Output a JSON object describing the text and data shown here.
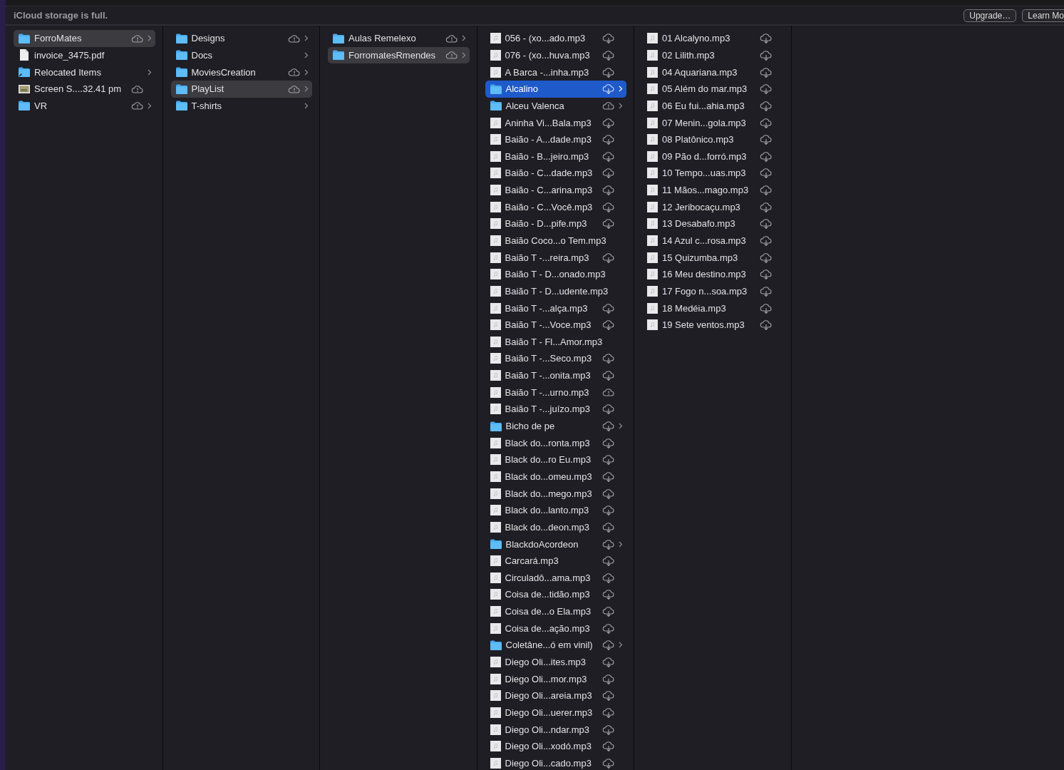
{
  "banner": {
    "message": "iCloud storage is full.",
    "buttons": [
      "Upgrade…",
      "Learn Mo"
    ]
  },
  "columns": [
    {
      "active": false,
      "items": [
        {
          "name": "ForroMates",
          "kind": "folder",
          "sync_warning": true,
          "needs_download": false,
          "selected": true
        },
        {
          "name": "invoice_3475.pdf",
          "kind": "document",
          "sync_warning": false,
          "needs_download": false,
          "selected": false
        },
        {
          "name": "Relocated Items",
          "kind": "alias",
          "sync_warning": false,
          "needs_download": false,
          "selected": false
        },
        {
          "name": "Screen S....32.41 pm",
          "kind": "image",
          "sync_warning": true,
          "needs_download": false,
          "selected": false
        },
        {
          "name": "VR",
          "kind": "folder",
          "sync_warning": true,
          "needs_download": false,
          "selected": false
        }
      ]
    },
    {
      "active": false,
      "items": [
        {
          "name": "Designs",
          "kind": "folder",
          "sync_warning": true,
          "needs_download": false,
          "selected": false
        },
        {
          "name": "Docs",
          "kind": "folder",
          "sync_warning": false,
          "needs_download": false,
          "selected": false
        },
        {
          "name": "MoviesCreation",
          "kind": "folder",
          "sync_warning": true,
          "needs_download": false,
          "selected": false
        },
        {
          "name": "PlayList",
          "kind": "folder",
          "sync_warning": true,
          "needs_download": false,
          "selected": true
        },
        {
          "name": "T-shirts",
          "kind": "folder",
          "sync_warning": false,
          "needs_download": false,
          "selected": false
        }
      ]
    },
    {
      "active": false,
      "items": [
        {
          "name": "Aulas Remelexo",
          "kind": "folder",
          "sync_warning": true,
          "needs_download": false,
          "selected": false
        },
        {
          "name": "ForromatesRmendes",
          "kind": "folder",
          "sync_warning": true,
          "needs_download": false,
          "selected": true
        }
      ]
    },
    {
      "active": true,
      "items": [
        {
          "name": "056 - (xo...ado.mp3",
          "kind": "audio",
          "sync_warning": false,
          "needs_download": true,
          "selected": false
        },
        {
          "name": "076 - (xo...huva.mp3",
          "kind": "audio",
          "sync_warning": false,
          "needs_download": true,
          "selected": false
        },
        {
          "name": "A Barca -...inha.mp3",
          "kind": "audio",
          "sync_warning": false,
          "needs_download": true,
          "selected": false
        },
        {
          "name": "Alcalino",
          "kind": "folder",
          "sync_warning": false,
          "needs_download": true,
          "selected": true
        },
        {
          "name": "Alceu Valenca",
          "kind": "folder",
          "sync_warning": true,
          "needs_download": false,
          "selected": false
        },
        {
          "name": "Aninha Vi...Bala.mp3",
          "kind": "audio",
          "sync_warning": false,
          "needs_download": true,
          "selected": false
        },
        {
          "name": "Baião - A...dade.mp3",
          "kind": "audio",
          "sync_warning": false,
          "needs_download": true,
          "selected": false
        },
        {
          "name": "Baião - B...jeiro.mp3",
          "kind": "audio",
          "sync_warning": false,
          "needs_download": true,
          "selected": false
        },
        {
          "name": "Baião - C...dade.mp3",
          "kind": "audio",
          "sync_warning": false,
          "needs_download": true,
          "selected": false
        },
        {
          "name": "Baião - C...arina.mp3",
          "kind": "audio",
          "sync_warning": false,
          "needs_download": true,
          "selected": false
        },
        {
          "name": "Baião - C...Você.mp3",
          "kind": "audio",
          "sync_warning": false,
          "needs_download": true,
          "selected": false
        },
        {
          "name": "Baião - D...pife.mp3",
          "kind": "audio",
          "sync_warning": false,
          "needs_download": true,
          "selected": false
        },
        {
          "name": "Baião Coco...o Tem.mp3",
          "kind": "audio",
          "sync_warning": false,
          "needs_download": false,
          "selected": false
        },
        {
          "name": "Baião T -...reira.mp3",
          "kind": "audio",
          "sync_warning": false,
          "needs_download": true,
          "selected": false
        },
        {
          "name": "Baião T - D...onado.mp3",
          "kind": "audio",
          "sync_warning": false,
          "needs_download": false,
          "selected": false
        },
        {
          "name": "Baião T - D...udente.mp3",
          "kind": "audio",
          "sync_warning": false,
          "needs_download": false,
          "selected": false
        },
        {
          "name": "Baião T -...alça.mp3",
          "kind": "audio",
          "sync_warning": false,
          "needs_download": true,
          "selected": false
        },
        {
          "name": "Baião T -...Voce.mp3",
          "kind": "audio",
          "sync_warning": false,
          "needs_download": true,
          "selected": false
        },
        {
          "name": "Baião T - Fl...Amor.mp3",
          "kind": "audio",
          "sync_warning": false,
          "needs_download": false,
          "selected": false
        },
        {
          "name": "Baião T -...Seco.mp3",
          "kind": "audio",
          "sync_warning": false,
          "needs_download": true,
          "selected": false
        },
        {
          "name": "Baião T -...onita.mp3",
          "kind": "audio",
          "sync_warning": false,
          "needs_download": true,
          "selected": false
        },
        {
          "name": "Baião T -...urno.mp3",
          "kind": "audio",
          "sync_warning": true,
          "needs_download": false,
          "selected": false
        },
        {
          "name": "Baião T -...juízo.mp3",
          "kind": "audio",
          "sync_warning": false,
          "needs_download": true,
          "selected": false
        },
        {
          "name": "Bicho de pe",
          "kind": "folder",
          "sync_warning": false,
          "needs_download": true,
          "selected": false
        },
        {
          "name": "Black do...ronta.mp3",
          "kind": "audio",
          "sync_warning": false,
          "needs_download": true,
          "selected": false
        },
        {
          "name": "Black do...ro Eu.mp3",
          "kind": "audio",
          "sync_warning": false,
          "needs_download": true,
          "selected": false
        },
        {
          "name": "Black do...omeu.mp3",
          "kind": "audio",
          "sync_warning": false,
          "needs_download": true,
          "selected": false
        },
        {
          "name": "Black do...mego.mp3",
          "kind": "audio",
          "sync_warning": false,
          "needs_download": true,
          "selected": false
        },
        {
          "name": "Black do...lanto.mp3",
          "kind": "audio",
          "sync_warning": false,
          "needs_download": true,
          "selected": false
        },
        {
          "name": "Black do...deon.mp3",
          "kind": "audio",
          "sync_warning": false,
          "needs_download": true,
          "selected": false
        },
        {
          "name": "BlackdoAcordeon",
          "kind": "folder",
          "sync_warning": false,
          "needs_download": true,
          "selected": false
        },
        {
          "name": "Carcará.mp3",
          "kind": "audio",
          "sync_warning": false,
          "needs_download": true,
          "selected": false
        },
        {
          "name": "Circuladô...ama.mp3",
          "kind": "audio",
          "sync_warning": false,
          "needs_download": true,
          "selected": false
        },
        {
          "name": "Coisa de...tidão.mp3",
          "kind": "audio",
          "sync_warning": false,
          "needs_download": true,
          "selected": false
        },
        {
          "name": "Coisa de...o Ela.mp3",
          "kind": "audio",
          "sync_warning": false,
          "needs_download": true,
          "selected": false
        },
        {
          "name": "Coisa de...ação.mp3",
          "kind": "audio",
          "sync_warning": false,
          "needs_download": true,
          "selected": false
        },
        {
          "name": "Coletâne...ó em vinil)",
          "kind": "folder",
          "sync_warning": false,
          "needs_download": true,
          "selected": false
        },
        {
          "name": "Diego Oli...ites.mp3",
          "kind": "audio",
          "sync_warning": false,
          "needs_download": true,
          "selected": false
        },
        {
          "name": "Diego Oli...mor.mp3",
          "kind": "audio",
          "sync_warning": false,
          "needs_download": true,
          "selected": false
        },
        {
          "name": "Diego Oli...areia.mp3",
          "kind": "audio",
          "sync_warning": false,
          "needs_download": true,
          "selected": false
        },
        {
          "name": "Diego Oli...uerer.mp3",
          "kind": "audio",
          "sync_warning": false,
          "needs_download": true,
          "selected": false
        },
        {
          "name": "Diego Oli...ndar.mp3",
          "kind": "audio",
          "sync_warning": false,
          "needs_download": true,
          "selected": false
        },
        {
          "name": "Diego Oli...xodó.mp3",
          "kind": "audio",
          "sync_warning": false,
          "needs_download": true,
          "selected": false
        },
        {
          "name": "Diego Oli...cado.mp3",
          "kind": "audio",
          "sync_warning": false,
          "needs_download": true,
          "selected": false
        }
      ]
    },
    {
      "items": [
        {
          "name": "01 Alcalyno.mp3",
          "kind": "audio",
          "sync_warning": false,
          "needs_download": true,
          "selected": false
        },
        {
          "name": "02 Lilith.mp3",
          "kind": "audio",
          "sync_warning": false,
          "needs_download": true,
          "selected": false
        },
        {
          "name": "04 Aquariana.mp3",
          "kind": "audio",
          "sync_warning": false,
          "needs_download": true,
          "selected": false
        },
        {
          "name": "05 Além do mar.mp3",
          "kind": "audio",
          "sync_warning": false,
          "needs_download": true,
          "selected": false
        },
        {
          "name": "06 Eu fui...ahia.mp3",
          "kind": "audio",
          "sync_warning": false,
          "needs_download": true,
          "selected": false
        },
        {
          "name": "07 Menin...gola.mp3",
          "kind": "audio",
          "sync_warning": false,
          "needs_download": true,
          "selected": false
        },
        {
          "name": "08 Platônico.mp3",
          "kind": "audio",
          "sync_warning": false,
          "needs_download": true,
          "selected": false
        },
        {
          "name": "09 Pão d...forró.mp3",
          "kind": "audio",
          "sync_warning": false,
          "needs_download": true,
          "selected": false
        },
        {
          "name": "10 Tempo...uas.mp3",
          "kind": "audio",
          "sync_warning": false,
          "needs_download": true,
          "selected": false
        },
        {
          "name": "11 Mãos...mago.mp3",
          "kind": "audio",
          "sync_warning": false,
          "needs_download": true,
          "selected": false
        },
        {
          "name": "12 Jeribocaçu.mp3",
          "kind": "audio",
          "sync_warning": false,
          "needs_download": true,
          "selected": false
        },
        {
          "name": "13 Desabafo.mp3",
          "kind": "audio",
          "sync_warning": false,
          "needs_download": true,
          "selected": false
        },
        {
          "name": "14 Azul c...rosa.mp3",
          "kind": "audio",
          "sync_warning": false,
          "needs_download": true,
          "selected": false
        },
        {
          "name": "15 Quizumba.mp3",
          "kind": "audio",
          "sync_warning": false,
          "needs_download": true,
          "selected": false
        },
        {
          "name": "16 Meu destino.mp3",
          "kind": "audio",
          "sync_warning": false,
          "needs_download": true,
          "selected": false
        },
        {
          "name": "17 Fogo n...soa.mp3",
          "kind": "audio",
          "sync_warning": false,
          "needs_download": true,
          "selected": false
        },
        {
          "name": "18 Medéia.mp3",
          "kind": "audio",
          "sync_warning": false,
          "needs_download": true,
          "selected": false
        },
        {
          "name": "19 Sete ventos.mp3",
          "kind": "audio",
          "sync_warning": false,
          "needs_download": true,
          "selected": false
        }
      ]
    }
  ]
}
